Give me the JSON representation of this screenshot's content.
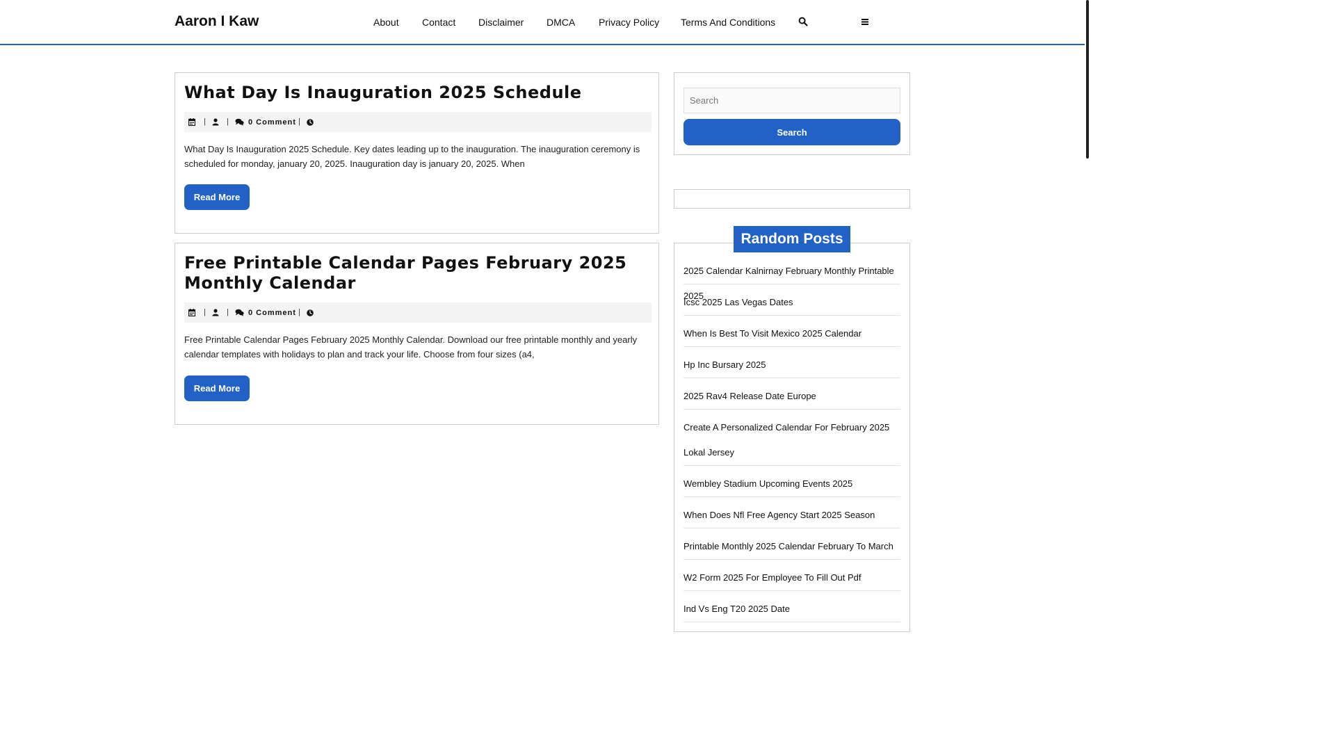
{
  "site": {
    "title": "Aaron I Kaw"
  },
  "nav": {
    "items": [
      "About",
      "Contact",
      "Disclaimer",
      "DMCA",
      "Privacy Policy",
      "Terms And Conditions"
    ]
  },
  "header_icons": {
    "search": "search-icon",
    "menu": "menu-icon"
  },
  "colors": {
    "accent": "#2262c6",
    "border": "#cccccc",
    "meta_bg": "#f4f4f4"
  },
  "posts": [
    {
      "title": "What Day Is Inauguration 2025 Schedule",
      "comment": "0 Comment",
      "excerpt": "What Day Is Inauguration 2025 Schedule. Key dates leading up to the inauguration. The inauguration ceremony is scheduled for monday, january 20, 2025. Inauguration day is january 20, 2025. When",
      "read_more": "Read More"
    },
    {
      "title": "Free Printable Calendar Pages February 2025 Monthly Calendar",
      "comment": "0 Comment",
      "excerpt": "Free Printable Calendar Pages February 2025 Monthly Calendar. Download our free printable monthly and yearly calendar templates with holidays to plan and track your life. Choose from four sizes (a4,",
      "read_more": "Read More"
    }
  ],
  "meta_separator": "|",
  "sidebar": {
    "search": {
      "placeholder": "Search",
      "button": "Search"
    },
    "random_posts": {
      "title": "Random Posts",
      "items": [
        "2025 Calendar Kalnirnay February Monthly Printable 2025",
        "Icsc 2025 Las Vegas Dates",
        "When Is Best To Visit Mexico 2025 Calendar",
        "Hp Inc Bursary 2025",
        "2025 Rav4 Release Date Europe",
        "Create A Personalized Calendar For February 2025 Lokal Jersey",
        "Wembley Stadium Upcoming Events 2025",
        "When Does Nfl Free Agency Start 2025 Season",
        "Printable Monthly 2025 Calendar February To March",
        "W2 Form 2025 For Employee To Fill Out Pdf",
        "Ind Vs Eng T20 2025 Date"
      ]
    }
  }
}
